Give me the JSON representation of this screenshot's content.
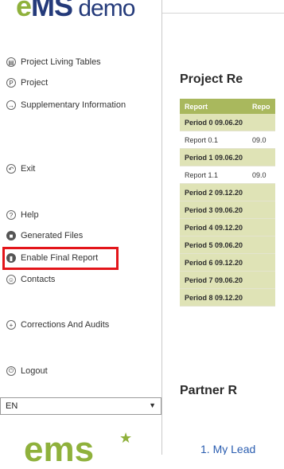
{
  "logo": {
    "brand_prefix": "e",
    "brand_mid": "MS",
    "brand_suffix": " demo"
  },
  "sidebar": {
    "items": [
      {
        "label": "Project Living Tables",
        "icon": "table-icon"
      },
      {
        "label": "Project",
        "icon": "project-icon"
      },
      {
        "label": "Supplementary Information",
        "icon": "info-icon"
      },
      {
        "label": "Exit",
        "icon": "exit-icon"
      },
      {
        "label": "Help",
        "icon": "help-icon"
      },
      {
        "label": "Generated Files",
        "icon": "files-icon"
      },
      {
        "label": "Enable Final Report",
        "icon": "report-icon"
      },
      {
        "label": "Contacts",
        "icon": "contacts-icon"
      },
      {
        "label": "Corrections And Audits",
        "icon": "plus-icon"
      },
      {
        "label": "Logout",
        "icon": "power-icon"
      }
    ],
    "language_select": {
      "value": "EN"
    }
  },
  "main": {
    "section1_title": "Project Re",
    "table": {
      "headers": [
        "Report",
        "Repo"
      ],
      "rows": [
        {
          "type": "period",
          "cells": [
            "Period 0 09.06.20",
            ""
          ]
        },
        {
          "type": "report",
          "cells": [
            "Report 0.1",
            "09.0"
          ]
        },
        {
          "type": "period",
          "cells": [
            "Period 1 09.06.20",
            ""
          ]
        },
        {
          "type": "report",
          "cells": [
            "Report 1.1",
            "09.0"
          ]
        },
        {
          "type": "period",
          "cells": [
            "Period 2 09.12.20",
            ""
          ]
        },
        {
          "type": "period",
          "cells": [
            "Period 3 09.06.20",
            ""
          ]
        },
        {
          "type": "period",
          "cells": [
            "Period 4 09.12.20",
            ""
          ]
        },
        {
          "type": "period",
          "cells": [
            "Period 5 09.06.20",
            ""
          ]
        },
        {
          "type": "period",
          "cells": [
            "Period 6 09.12.20",
            ""
          ]
        },
        {
          "type": "period",
          "cells": [
            "Period 7 09.06.20",
            ""
          ]
        },
        {
          "type": "period",
          "cells": [
            "Period 8 09.12.20",
            ""
          ]
        }
      ]
    },
    "section2_title": "Partner R",
    "bottom_link": "1. My Lead"
  },
  "colors": {
    "accent": "#a9b85d",
    "period_row": "#dfe3b6",
    "highlight": "#e3151a",
    "brand_blue": "#243a7a",
    "brand_green": "#8fb13c"
  }
}
